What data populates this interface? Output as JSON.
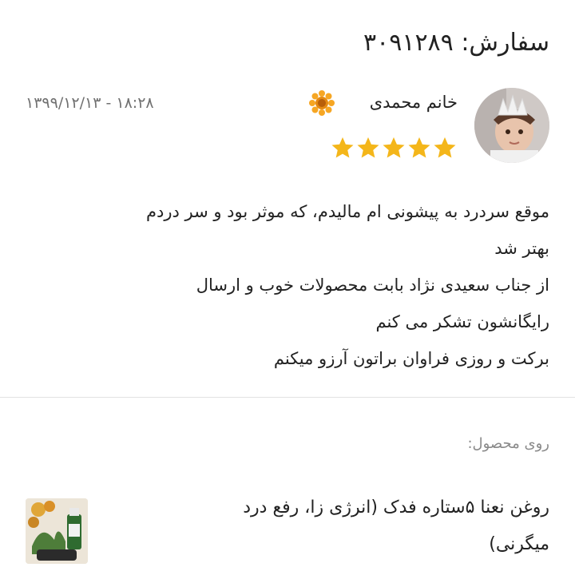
{
  "order": {
    "label": "سفارش:",
    "number": "۳۰۹۱۲۸۹"
  },
  "reviewer": {
    "name": "خانم محمدی",
    "rating": 5
  },
  "review": {
    "date": "۱۳۹۹/۱۲/۱۳ - ۱۸:۲۸",
    "lines": [
      "موقع سردرد به پیشونی ام مالیدم، که موثر بود و سر دردم",
      "بهتر شد",
      "از جناب سعیدی نژاد بابت محصولات خوب و ارسال",
      "رایگانشون تشکر می کنم",
      "برکت و روزی فراوان براتون آرزو میکنم"
    ]
  },
  "product": {
    "caption": "روی محصول:",
    "name_lines": [
      "روغن نعنا ۵ستاره فدک (انرژی زا، رفع درد",
      "میگرنی)"
    ]
  },
  "icons": {
    "avatar": "avatar-photo-icon",
    "emoji": "sunflower-icon",
    "star": "star-icon",
    "thumb": "product-photo-icon"
  },
  "colors": {
    "star": "#f4b61a",
    "muted_text": "#707070",
    "divider": "#e2e2e2"
  }
}
